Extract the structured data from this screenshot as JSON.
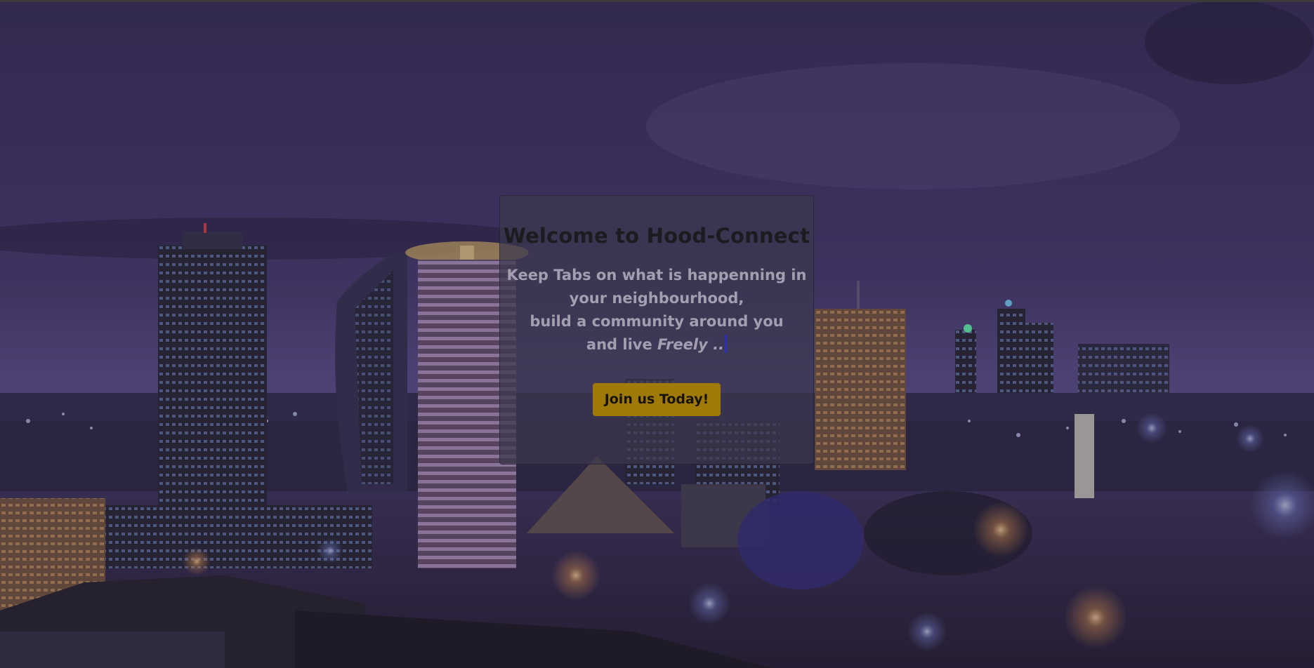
{
  "hero": {
    "background_description": "night city skyline",
    "overlay_color": "#3b2f5c"
  },
  "welcome_card": {
    "title": "Welcome to Hood-Connect",
    "tagline_line1": "Keep Tabs on what is happenning in",
    "tagline_line2": "your neighbourhood,",
    "tagline_line3": "build a community around you",
    "tagline_line4_prefix": "and live ",
    "tagline_line4_emphasis": "Freely",
    "tagline_line4_suffix": " ..",
    "cta_label": "Join us Today!",
    "cta_color": "#9f7a09"
  }
}
